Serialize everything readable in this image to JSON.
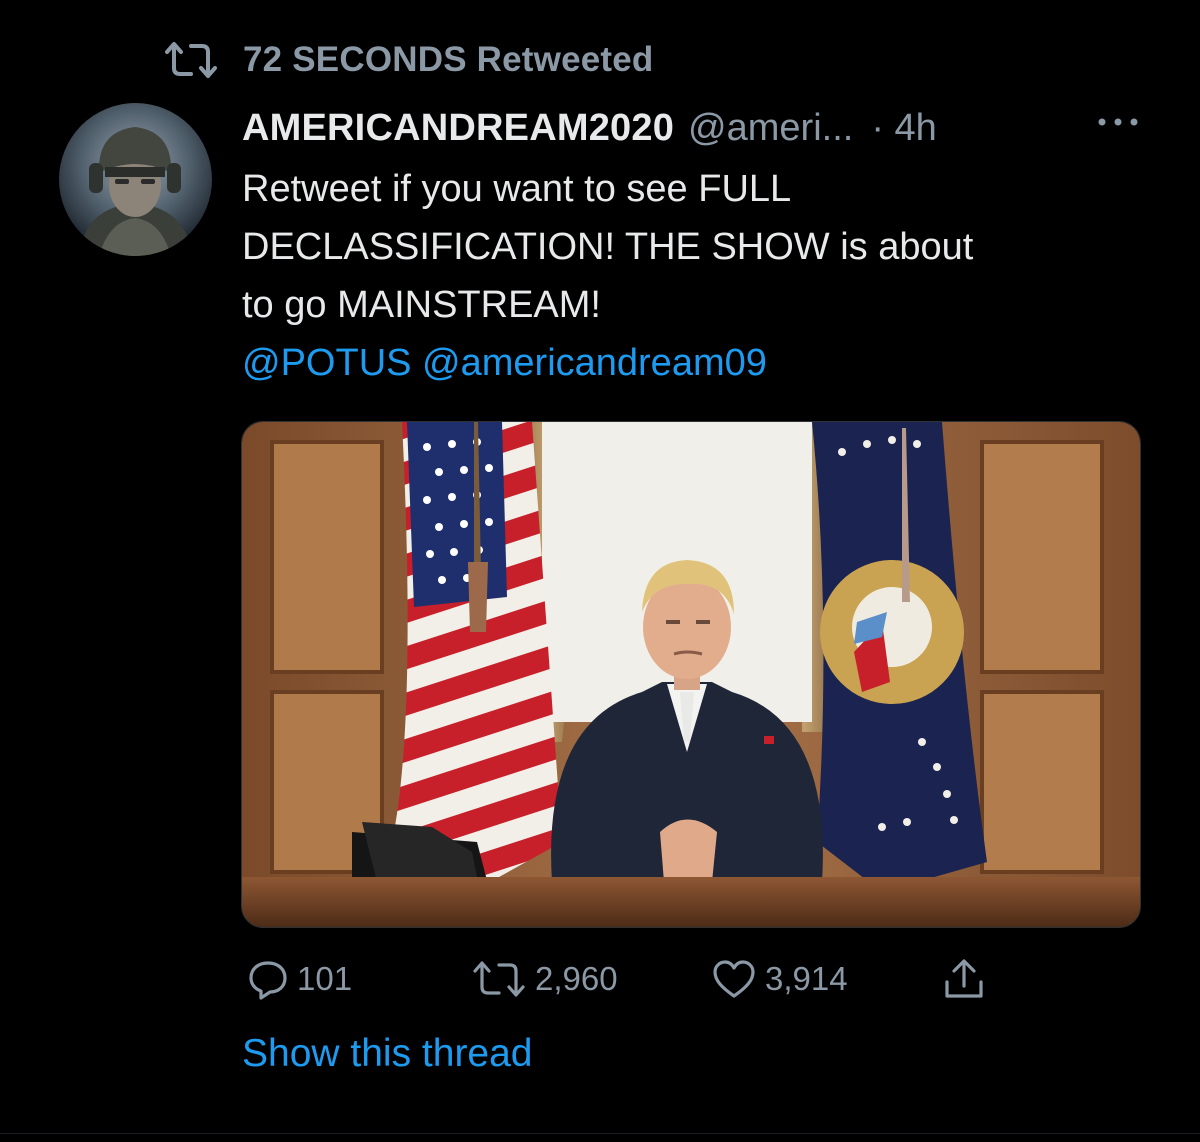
{
  "retweet_context": {
    "label": "72 SECONDS Retweeted",
    "icon": "retweet-icon"
  },
  "author": {
    "display_name": "AMERICANDREAM2020",
    "handle": "@ameri...",
    "time": "· 4h",
    "avatar_icon": "soldier-avatar"
  },
  "tweet": {
    "text_lines": [
      "Retweet if you want to see FULL",
      "DECLASSIFICATION! THE SHOW is about",
      "to go MAINSTREAM!"
    ],
    "mentions": "@POTUS @americandream09"
  },
  "actions": {
    "reply_count": "101",
    "retweet_count": "2,960",
    "like_count": "3,914"
  },
  "show_thread_label": "Show this thread",
  "colors": {
    "background": "#000000",
    "accent": "#1d9bf0",
    "secondary_text": "#8b98a5",
    "primary_text": "#e7e9ea"
  }
}
